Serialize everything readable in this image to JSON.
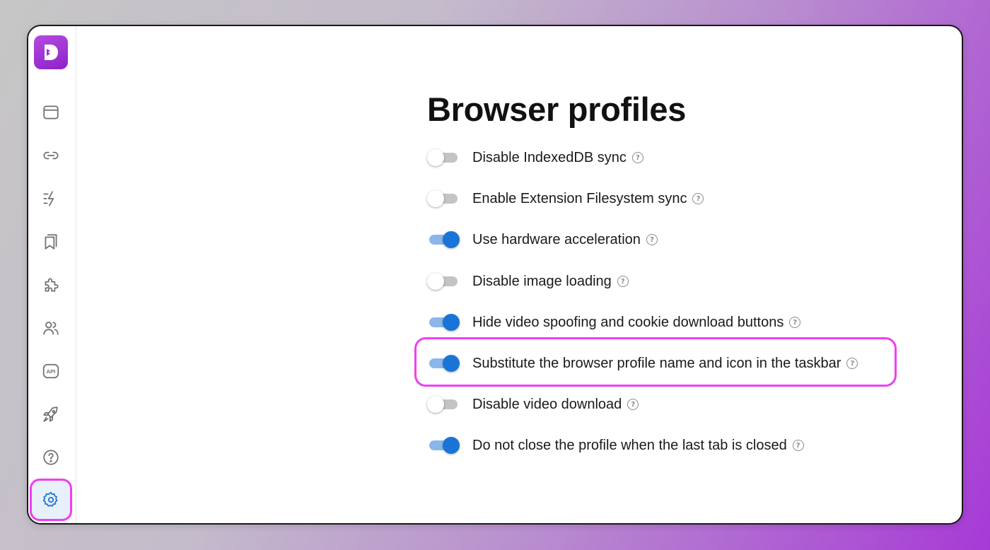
{
  "app": {
    "logo_letter": "D"
  },
  "sidebar": {
    "items": [
      {
        "name": "profiles",
        "icon": "browser-window-icon",
        "active": false
      },
      {
        "name": "proxies",
        "icon": "link-icon",
        "active": false
      },
      {
        "name": "automation",
        "icon": "lightning-icon",
        "active": false
      },
      {
        "name": "bookmarks",
        "icon": "bookmarks-icon",
        "active": false
      },
      {
        "name": "extensions",
        "icon": "puzzle-icon",
        "active": false
      },
      {
        "name": "team",
        "icon": "users-icon",
        "active": false
      },
      {
        "name": "api",
        "icon": "api-icon",
        "active": false,
        "text": "API"
      },
      {
        "name": "quick-start",
        "icon": "rocket-icon",
        "active": false
      },
      {
        "name": "help",
        "icon": "question-icon",
        "active": false
      },
      {
        "name": "settings",
        "icon": "gear-icon",
        "active": true
      }
    ]
  },
  "main": {
    "title": "Browser profiles",
    "settings": [
      {
        "label": "Disable IndexedDB sync",
        "enabled": false
      },
      {
        "label": "Enable Extension Filesystem sync",
        "enabled": false
      },
      {
        "label": "Use hardware acceleration",
        "enabled": true
      },
      {
        "label": "Disable image loading",
        "enabled": false
      },
      {
        "label": "Hide video spoofing and cookie download buttons",
        "enabled": true
      },
      {
        "label": "Substitute the browser profile name and icon in the taskbar",
        "enabled": true,
        "highlighted": true
      },
      {
        "label": "Disable video download",
        "enabled": false
      },
      {
        "label": "Do not close the profile when the last tab is closed",
        "enabled": true
      }
    ],
    "help_glyph": "?"
  },
  "colors": {
    "accent": "#1a74d8",
    "highlight": "#f03ef2",
    "logo": "#9b2fd0"
  }
}
